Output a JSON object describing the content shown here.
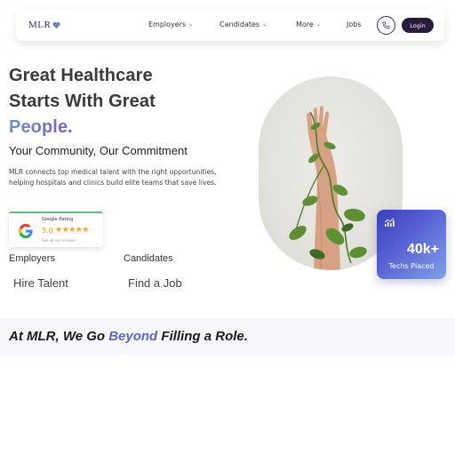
{
  "nav": {
    "logo": "MLR",
    "items": [
      {
        "label": "Employers",
        "chevron": true
      },
      {
        "label": "Candidates",
        "chevron": true
      },
      {
        "label": "More",
        "chevron": true
      },
      {
        "label": "Jobs",
        "chevron": false
      }
    ],
    "login_label": "Login"
  },
  "hero": {
    "line1": "Great Healthcare",
    "line2": "Starts With Great",
    "line3": "People.",
    "subtitle": "Your Community, Our Commitment",
    "description": "MLR connects top medical talent with the right opportunities, helping hospitals and clinics build elite teams that save lives."
  },
  "rating": {
    "title": "Google Rating",
    "score": "5.0",
    "stars": "★★★★★",
    "link": "See all our reviews"
  },
  "columns": {
    "employers_heading": "Employers",
    "employers_link": "Hire Talent",
    "candidates_heading": "Candidates",
    "candidates_link": "Find a Job"
  },
  "stat": {
    "value": "40k+",
    "label": "Techs Placed"
  },
  "tagline": {
    "before": "At MLR, We Go ",
    "highlight": "Beyond",
    "after": " Filling a Role."
  },
  "colors": {
    "brand_dark": "#2a1a3c",
    "accent_gradient_start": "#6a8fd8",
    "accent_gradient_end": "#7b5cc8",
    "stat_card": "#4a52c8"
  }
}
